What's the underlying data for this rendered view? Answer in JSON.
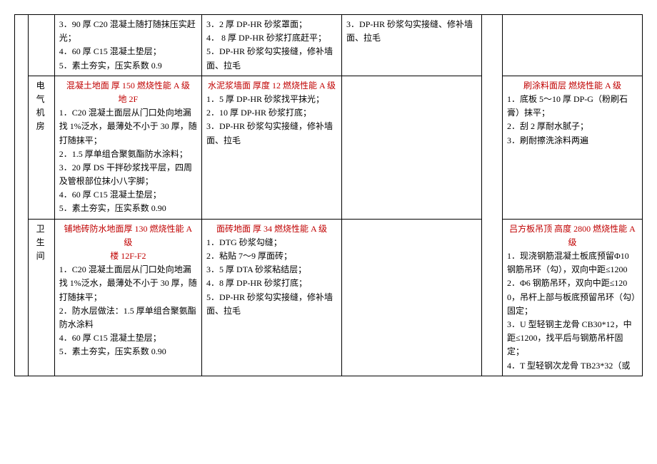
{
  "rows": [
    {
      "label": "",
      "c": {
        "title": "",
        "subtitle": "",
        "items": [
          "3．90 厚 C20 混凝土随打随抹压实赶光；",
          "4．60 厚 C15 混凝土垫层；",
          "5．素土夯实，压实系数 0.9"
        ]
      },
      "d": {
        "title": "",
        "items": [
          "3．2 厚 DP-HR 砂浆罩面；",
          "4．  8 厚 DP-HR 砂浆打底赶平；",
          "5．DP-HR 砂浆勾实接缝，修补墙面、拉毛"
        ]
      },
      "e": {
        "title": "",
        "items": [
          "3．DP-HR 砂浆勾实接缝、修补墙面、拉毛"
        ]
      },
      "g": {
        "title": "",
        "items": []
      }
    },
    {
      "label": "电气机房",
      "c": {
        "title": "混凝土地面 厚 150 燃烧性能 A 级",
        "subtitle": "地 2F",
        "items": [
          "1．C20 混凝土面层从门口处向地漏找 1%泛水，最薄处不小于 30 厚，随打随抹平；",
          "2．1.5 厚单组合聚氨酯防水涂料；",
          "3．20 厚 DS 干拌砂浆找平层，四周及管根部位抹小八字脚；",
          "4．60 厚 C15 混凝土垫层；",
          "5．素土夯实，压实系数 0.90"
        ]
      },
      "d": {
        "title": "水泥浆墙面 厚度 12 燃烧性能 A 级",
        "items": [
          "1．5 厚 DP-HR 砂浆找平抹光；",
          "2．10 厚 DP-HR 砂浆打底；",
          "3．DP-HR 砂浆勾实接缝，修补墙面、拉毛"
        ]
      },
      "e": {
        "title": "",
        "items": []
      },
      "g": {
        "title": "刷涂料面层 燃烧性能 A 级",
        "items": [
          "1．底板 5～10 厚 DP-G（粉刷石膏）抹平；",
          "2．刮 2 厚耐水腻子；",
          "3．刷耐擦洗涂料两遍"
        ]
      }
    },
    {
      "label": "卫生间",
      "c": {
        "title": "铺地砖防水地面厚 130 燃烧性能 A 级",
        "subtitle": "楼 12F-F2",
        "items": [
          "1．C20 混凝土面层从门口处向地漏找 1%泛水，最薄处不小于 30 厚，随打随抹平；",
          "2．防水层做法：1.5 厚单组合聚氨酯防水涂料",
          "4．60 厚 C15 混凝土垫层；",
          "5．素土夯实，压实系数 0.90"
        ]
      },
      "d": {
        "title": "面砖地面 厚 34 燃烧性能 A 级",
        "items": [
          "1．DTG 砂浆勾缝；",
          "2．粘贴 7～9 厚面砖；",
          "3．5 厚 DTA 砂浆粘结层；",
          "4．8 厚 DP-HR 砂浆打底；",
          "5．DP-HR 砂浆勾实接缝，修补墙面、拉毛"
        ]
      },
      "e": {
        "title": "",
        "items": []
      },
      "g": {
        "title": "吕方板吊顶 高度 2800 燃烧性能 A 级",
        "items": [
          "1．现浇钢筋混凝土板底预留Φ10 钢筋吊环（勾），双向中距≤1200",
          "2．Φ6 钢筋吊环，双向中距≤1200，吊杆上部与板底预留吊环（勾）固定；",
          "3．U 型轻钢主龙骨 CB30*12，中距≤1200，找平后与钢筋吊杆固定；",
          "4．T 型轻钢次龙骨 TB23*32（或"
        ]
      }
    }
  ]
}
